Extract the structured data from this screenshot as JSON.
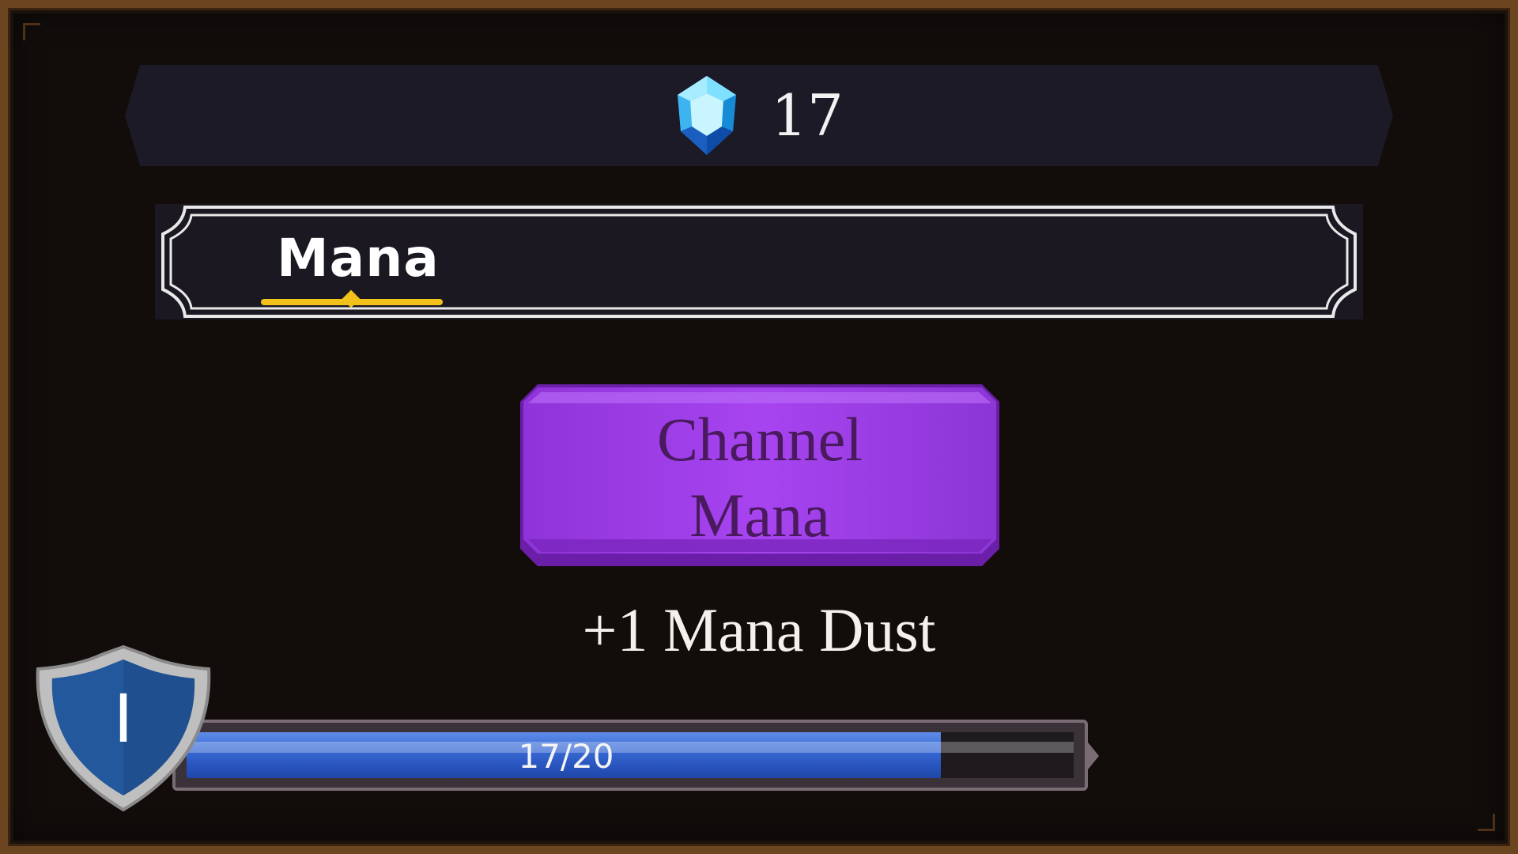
{
  "currency": {
    "icon": "mana-gem-icon",
    "value": "17",
    "color": "#3ec3f4"
  },
  "tabs": [
    {
      "label": "Mana",
      "selected": true
    }
  ],
  "action_button": {
    "label": "Channel\nMana",
    "color": "#9b3be6"
  },
  "reward": {
    "text": "+1 Mana Dust"
  },
  "level": {
    "value": "I",
    "icon": "shield-icon"
  },
  "xp": {
    "current": 17,
    "max": 20,
    "label": "17/20",
    "fill_fraction": 0.85
  }
}
